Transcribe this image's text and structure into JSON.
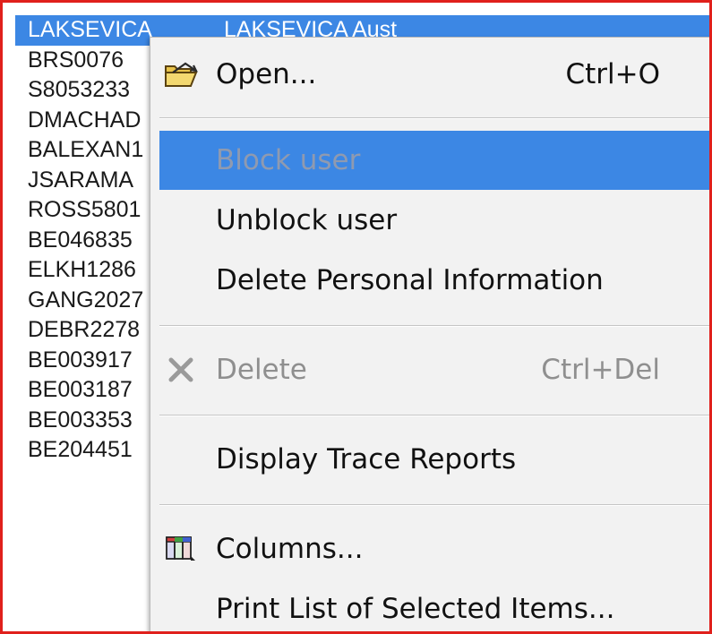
{
  "list": {
    "selected": {
      "name": "LAKSEVICA",
      "detail": "LAKSEVICA Aust"
    },
    "rows": [
      "BRS0076",
      "S8053233",
      "DMACHAD",
      "BALEXAN1",
      "JSARAMA",
      "ROSS5801",
      "BE046835",
      "ELKH1286",
      "GANG2027",
      "DEBR2278",
      "BE003917",
      "BE003187",
      "BE003353",
      "BE204451"
    ]
  },
  "menu": {
    "open": {
      "label": "Open...",
      "shortcut": "Ctrl+O",
      "icon": "folder-open-icon"
    },
    "block_user": {
      "label": "Block user",
      "state": "highlighted-disabled"
    },
    "unblock_user": {
      "label": "Unblock user"
    },
    "delete_personal": {
      "label": "Delete Personal Information"
    },
    "delete": {
      "label": "Delete",
      "shortcut": "Ctrl+Del",
      "icon": "delete-x-icon",
      "state": "disabled"
    },
    "display_trace": {
      "label": "Display Trace Reports"
    },
    "columns": {
      "label": "Columns...",
      "icon": "columns-icon"
    },
    "print_list": {
      "label": "Print List of Selected Items..."
    }
  },
  "colors": {
    "highlight": "#3c87e4",
    "border": "#e0201c",
    "menu_bg": "#f2f2f2",
    "disabled_text": "#8f8f8f"
  }
}
